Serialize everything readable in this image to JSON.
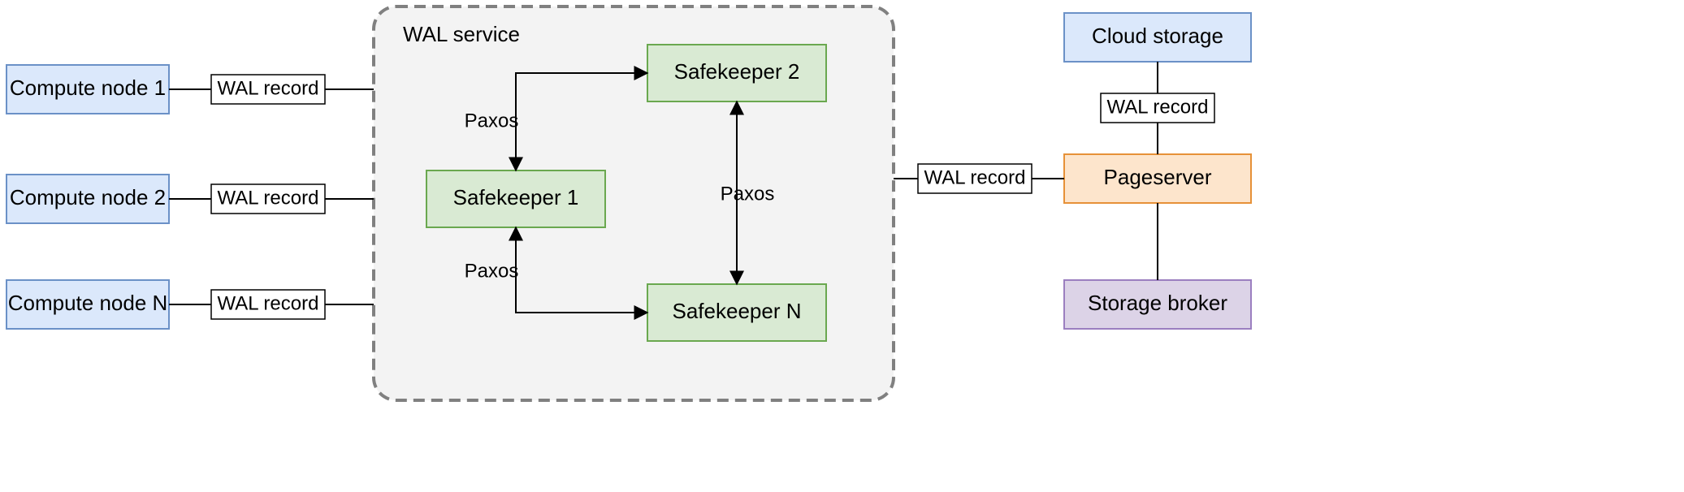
{
  "diagram": {
    "wal_service_title": "WAL service",
    "compute_nodes": [
      "Compute node 1",
      "Compute node 2",
      "Compute node N"
    ],
    "safekeepers": [
      "Safekeeper 1",
      "Safekeeper 2",
      "Safekeeper N"
    ],
    "right_stack": {
      "cloud_storage": "Cloud storage",
      "pageserver": "Pageserver",
      "storage_broker": "Storage broker"
    },
    "labels": {
      "wal_record": "WAL record",
      "paxos": "Paxos"
    }
  }
}
